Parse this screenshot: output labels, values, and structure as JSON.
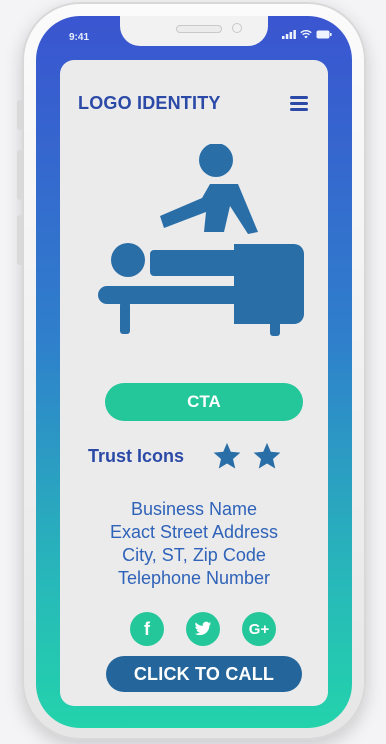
{
  "status_bar": {
    "time": "9:41"
  },
  "header": {
    "logo": "LOGO IDENTITY",
    "menu_icon": "hamburger-menu-icon"
  },
  "hero": {
    "icon": "massage-therapy-icon"
  },
  "cta": {
    "label": "CTA"
  },
  "trust": {
    "label": "Trust Icons",
    "stars": 2
  },
  "business": {
    "name": "Business Name",
    "address": "Exact Street Address",
    "city": "City, ST, Zip Code",
    "phone": "Telephone Number"
  },
  "socials": [
    {
      "icon": "facebook-icon",
      "glyph": "f"
    },
    {
      "icon": "twitter-icon",
      "glyph": "t"
    },
    {
      "icon": "google-plus-icon",
      "glyph": "G+"
    }
  ],
  "call_button": {
    "label": "CLICK TO CALL"
  },
  "colors": {
    "brand_blue": "#2b4aa8",
    "accent_green": "#23c79a",
    "call_button": "#24669b",
    "icon_blue": "#2a6ea8"
  }
}
